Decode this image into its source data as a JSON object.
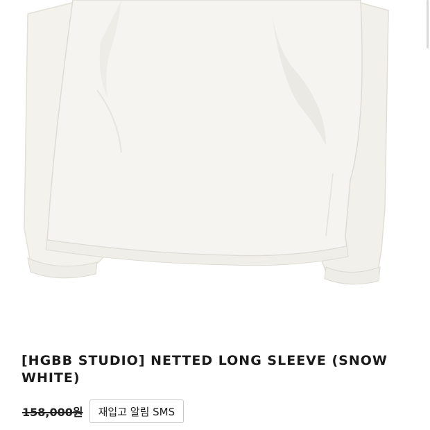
{
  "product": {
    "title": "[HGBB STUDIO] NETTED LONG SLEEVE (SNOW WHITE)",
    "price": "158,000원",
    "restock_sms_label": "재입고 알림 SMS"
  },
  "photo": {
    "subject": "snow white long sleeve shirt",
    "fabric_color": "#f2f1ec",
    "shadow_color": "#e2e0d9"
  }
}
